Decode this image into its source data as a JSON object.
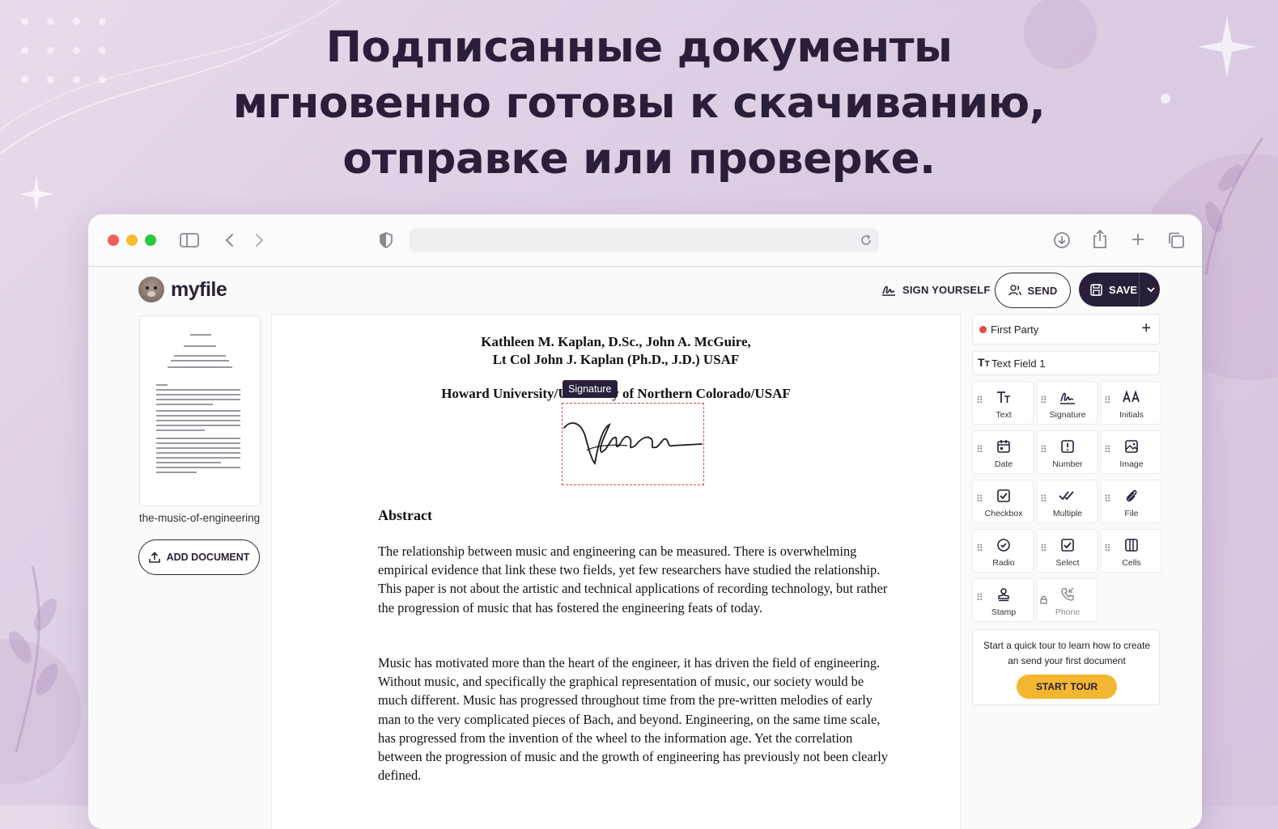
{
  "headline": {
    "line1": "Подписанные документы",
    "line2": "мгновенно готовы к скачиванию,",
    "line3": "отправке или проверке."
  },
  "browser": {
    "icons": [
      "sidebar-toggle-icon",
      "back-chevron-icon",
      "forward-chevron-icon",
      "shield-icon",
      "reload-icon",
      "download-icon",
      "share-icon",
      "new-tab-icon",
      "tabs-overview-icon"
    ],
    "traffic_lights": [
      "#ee5f57",
      "#f5bd2f",
      "#28c840"
    ]
  },
  "app": {
    "logo_text": "myfile",
    "sign_yourself_label": "SIGN YOURSELF",
    "send_label": "SEND",
    "save_label": "SAVE",
    "accent": "#2a1f3a",
    "tour_accent": "#f2b631"
  },
  "sidebar": {
    "document_name": "the-music-of-engineering",
    "add_document_label": "ADD DOCUMENT"
  },
  "document": {
    "authors_line1": "Kathleen M. Kaplan, D.Sc., John A. McGuire,",
    "authors_line2": "Lt Col John J. Kaplan (Ph.D., J.D.) USAF",
    "affiliation": "Howard University/University of Northern Colorado/USAF",
    "signature_tag": "Signature",
    "abstract_heading": "Abstract",
    "para1": "The relationship between music and engineering can be measured.  There is overwhelming empirical evidence that link these two fields, yet few researchers have studied the relationship.  This paper is not about the artistic and technical applications of recording technology, but rather the progression of music that has fostered the engineering feats of today.",
    "para2": "Music has motivated more than the heart of the engineer, it has driven the field of engineering.  Without music, and specifically the graphical representation of music, our society would be much different.  Music has progressed throughout time from the pre-written melodies of early man to the very complicated pieces of Bach, and beyond.  Engineering, on the same time scale, has progressed from the invention of the wheel to the information age.  Yet the correlation between the progression of music and the growth of engineering has previously not been clearly defined."
  },
  "panel": {
    "party_label": "First Party",
    "party_color": "#e5474f",
    "text_field_label": "Text Field 1",
    "tools": [
      {
        "label": "Text",
        "icon": "text-icon"
      },
      {
        "label": "Signature",
        "icon": "signature-icon"
      },
      {
        "label": "Initials",
        "icon": "initials-icon"
      },
      {
        "label": "Date",
        "icon": "calendar-icon"
      },
      {
        "label": "Number",
        "icon": "number-icon"
      },
      {
        "label": "Image",
        "icon": "image-icon"
      },
      {
        "label": "Checkbox",
        "icon": "checkbox-icon"
      },
      {
        "label": "Multiple",
        "icon": "multiple-check-icon"
      },
      {
        "label": "File",
        "icon": "paperclip-icon"
      },
      {
        "label": "Radio",
        "icon": "radio-icon"
      },
      {
        "label": "Select",
        "icon": "select-icon"
      },
      {
        "label": "Cells",
        "icon": "cells-icon"
      },
      {
        "label": "Stamp",
        "icon": "stamp-icon"
      },
      {
        "label": "Phone",
        "icon": "phone-icon"
      }
    ],
    "tour_message": "Start a quick tour to learn how to create an send your first document",
    "tour_button": "START TOUR"
  }
}
